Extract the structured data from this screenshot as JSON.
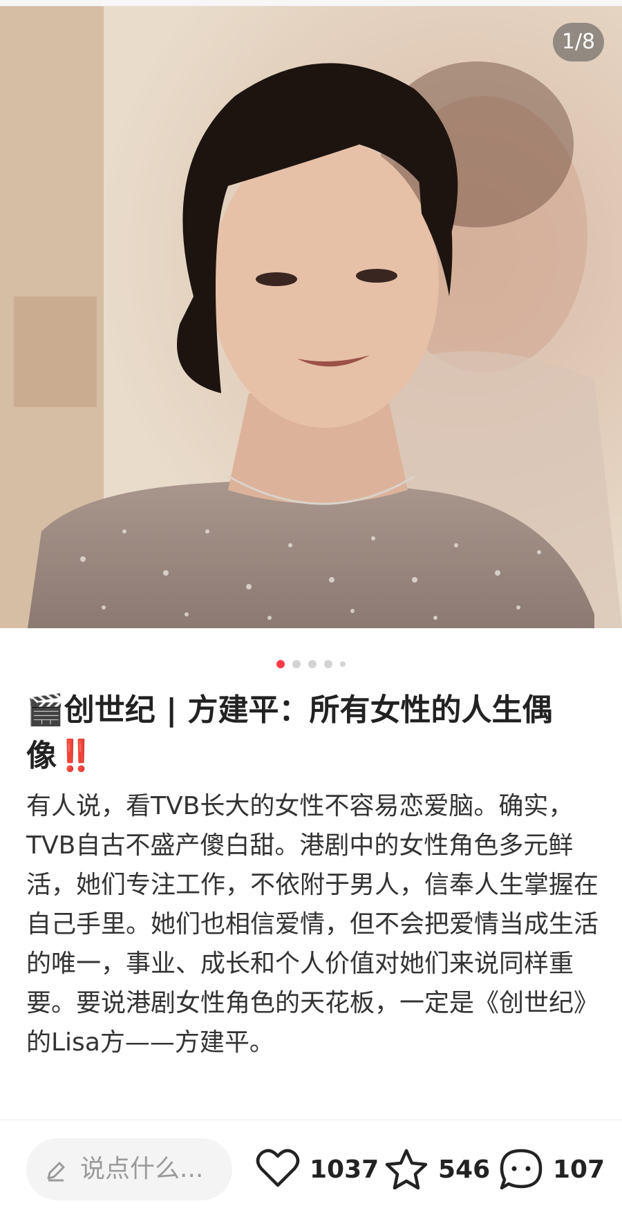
{
  "carousel": {
    "counter": "1/8",
    "total_dots": 5,
    "active_dot": 0
  },
  "post": {
    "emoji": "🎬",
    "title": "创世纪 | 方建平：所有女性的人生偶像",
    "title_suffix": "‼️",
    "paragraphs": [
      "有人说，看TVB长大的女性不容易恋爱脑。确实，TVB自古不盛产傻白甜。港剧中的女性角色多元鲜活，她们专注工作，不依附于男人，信奉人生掌握在自己手里。她们也相信爱情，但不会把爱情当成生活的唯一，事业、成长和个人价值对她们来说同样重要。要说港剧女性角色的天花板，一定是《创世纪》的Lisa方——方建平。"
    ]
  },
  "bottom_bar": {
    "comment_placeholder": "说点什么...",
    "likes": "1037",
    "favorites": "546",
    "comments": "107"
  },
  "colors": {
    "accent": "#ff3b4a",
    "icon": "#222222",
    "placeholder": "#9a9a9a"
  }
}
